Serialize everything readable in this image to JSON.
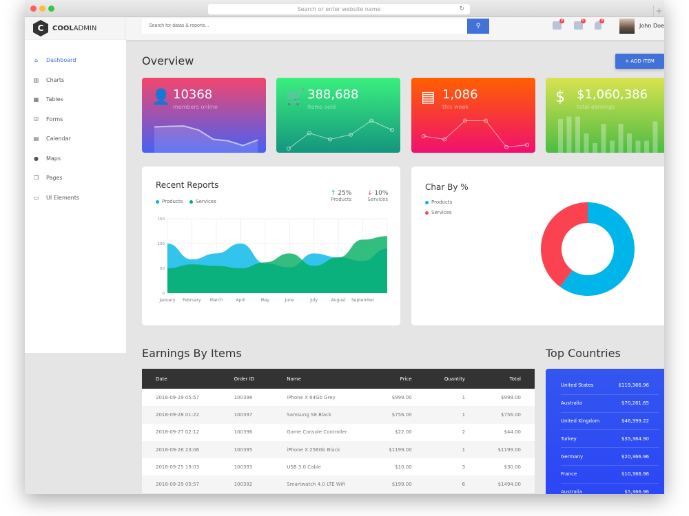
{
  "browser": {
    "url_placeholder": "Search or enter website name",
    "new_tab": "+"
  },
  "brand": {
    "logo_letter": "C",
    "name_bold": "COOL",
    "name_light": "ADMIN"
  },
  "sidebar": {
    "items": [
      {
        "label": "Dashboard",
        "icon": "⌂"
      },
      {
        "label": "Charts",
        "icon": "▥"
      },
      {
        "label": "Tables",
        "icon": "▦"
      },
      {
        "label": "Forms",
        "icon": "☑"
      },
      {
        "label": "Calendar",
        "icon": "▤"
      },
      {
        "label": "Maps",
        "icon": "●"
      },
      {
        "label": "Pages",
        "icon": "❐"
      },
      {
        "label": "UI Elements",
        "icon": "▭"
      }
    ]
  },
  "header": {
    "search_placeholder": "Search for datas & reports...",
    "search_icon": "⚲",
    "badges": [
      "0",
      "0",
      "0"
    ],
    "user_name": "John Doe"
  },
  "overview": {
    "title": "Overview",
    "add_item": "+ ADD ITEM"
  },
  "stats": [
    {
      "value": "10368",
      "label": "members online",
      "icon": "👤",
      "colors": [
        "#f2466c",
        "#4760f5"
      ],
      "mini": [
        70,
        72,
        73,
        60,
        30,
        25,
        10,
        28
      ]
    },
    {
      "value": "388,688",
      "label": "items sold",
      "icon": "🛒",
      "colors": [
        "#3bef7e",
        "#14957f"
      ],
      "mini": [
        0,
        50,
        30,
        45,
        90,
        60
      ]
    },
    {
      "value": "1,086",
      "label": "this week",
      "icon": "▤",
      "colors": [
        "#ff6000",
        "#f0106f"
      ],
      "mini": [
        40,
        30,
        90,
        90,
        5,
        12
      ]
    },
    {
      "value": "$1,060,386",
      "label": "total earnings",
      "icon": "$",
      "colors": [
        "#d9e34f",
        "#4dbb44"
      ],
      "mini": [
        70,
        75,
        75,
        40,
        20,
        60,
        25,
        60,
        40,
        25,
        25,
        65
      ]
    }
  ],
  "recent_reports": {
    "title": "Recent Reports",
    "kpis": [
      {
        "arrow": "↑",
        "value": "25%",
        "label": "Products",
        "color": "#00ad5f"
      },
      {
        "arrow": "↓",
        "value": "10%",
        "label": "Services",
        "color": "#fa4251"
      }
    ]
  },
  "char_by": {
    "title": "Char By %"
  },
  "chart_data": [
    {
      "type": "area",
      "title": "Recent Reports",
      "categories": [
        "January",
        "February",
        "March",
        "April",
        "May",
        "June",
        "July",
        "August",
        "September",
        ""
      ],
      "ylim": [
        0,
        150
      ],
      "yticks": [
        "0",
        "50",
        "100",
        "150"
      ],
      "series": [
        {
          "name": "Products",
          "color": "#00b5e9",
          "values": [
            100,
            68,
            80,
            100,
            60,
            52,
            80,
            72,
            65,
            90
          ]
        },
        {
          "name": "Services",
          "color": "#00ad5f",
          "values": [
            50,
            58,
            55,
            50,
            62,
            80,
            55,
            72,
            108,
            115
          ]
        }
      ]
    },
    {
      "type": "pie",
      "title": "Char By %",
      "series": [
        {
          "name": "Products",
          "color": "#00b5e9",
          "value": 60
        },
        {
          "name": "Services",
          "color": "#fa4251",
          "value": 40
        }
      ]
    }
  ],
  "earnings": {
    "title": "Earnings By Items",
    "columns": [
      "Date",
      "Order ID",
      "Name",
      "Price",
      "Quantity",
      "Total"
    ],
    "rows": [
      [
        "2018-09-29 05:57",
        "100398",
        "iPhone X 64Gb Grey",
        "$999.00",
        "1",
        "$999.00"
      ],
      [
        "2018-09-28 01:22",
        "100397",
        "Samsung S8 Black",
        "$756.00",
        "1",
        "$756.00"
      ],
      [
        "2018-09-27 02:12",
        "100396",
        "Game Console Controller",
        "$22.00",
        "2",
        "$44.00"
      ],
      [
        "2018-09-26 23:06",
        "100395",
        "iPhone X 256Gb Black",
        "$1199.00",
        "1",
        "$1199.00"
      ],
      [
        "2018-09-25 19:03",
        "100393",
        "USB 3.0 Cable",
        "$10.00",
        "3",
        "$30.00"
      ],
      [
        "2018-09-29 05:57",
        "100392",
        "Smartwatch 4.0 LTE Wifi",
        "$199.00",
        "6",
        "$1494.00"
      ]
    ]
  },
  "top_countries": {
    "title": "Top Countries",
    "rows": [
      [
        "United States",
        "$119,366.96"
      ],
      [
        "Australia",
        "$70,261.65"
      ],
      [
        "United Kingdom",
        "$46,399.22"
      ],
      [
        "Turkey",
        "$35,364.90"
      ],
      [
        "Germany",
        "$20,366.96"
      ],
      [
        "France",
        "$10,366.96"
      ],
      [
        "Australia",
        "$5,366.96"
      ]
    ]
  }
}
